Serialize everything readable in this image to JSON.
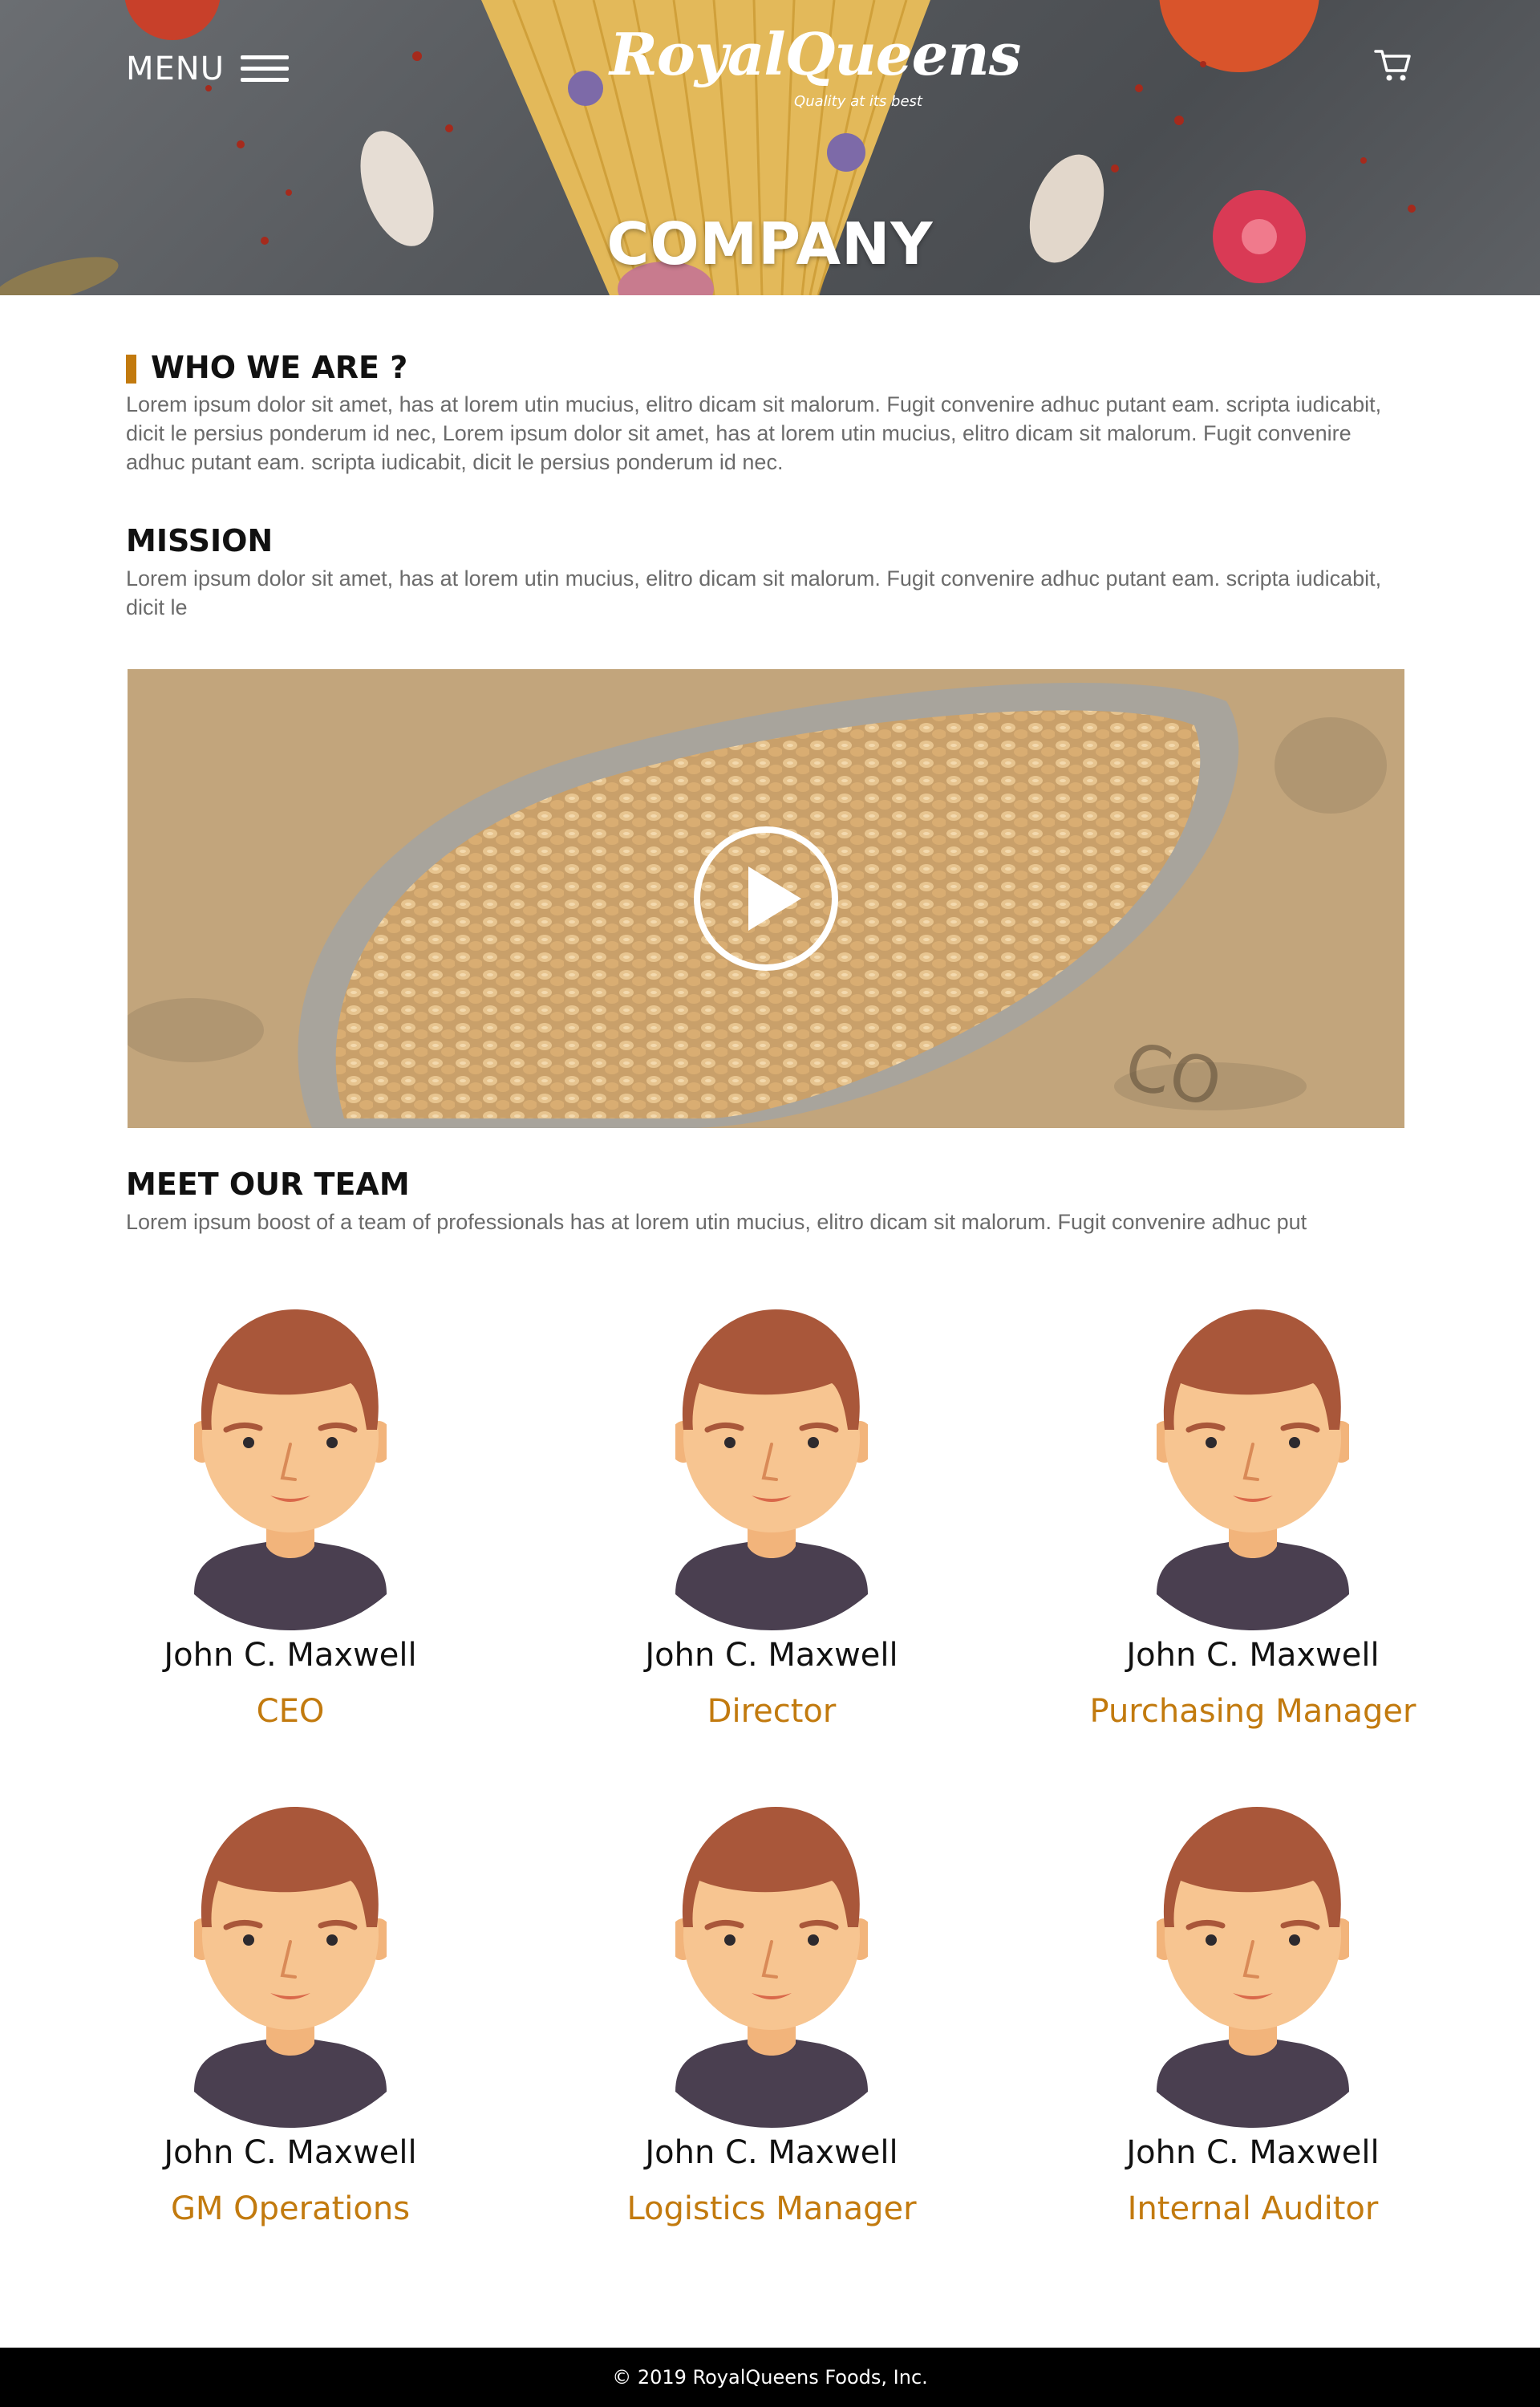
{
  "header": {
    "menu_label": "MENU",
    "logo_name": "RoyalQueens",
    "logo_tagline": "Quality at its best",
    "page_title": "COMPANY"
  },
  "who_we_are": {
    "title": "WHO WE ARE ?",
    "text": "Lorem ipsum dolor sit amet, has at lorem utin mucius, elitro dicam sit malorum. Fugit convenire adhuc putant eam. scripta iudicabit, dicit le persius ponderum id nec, Lorem ipsum dolor sit amet, has at lorem utin mucius, elitro dicam sit malorum. Fugit convenire adhuc putant eam. scripta iudicabit, dicit le persius ponderum id nec."
  },
  "mission": {
    "title": "MISSION",
    "text": "Lorem ipsum dolor sit amet, has at lorem utin mucius, elitro dicam sit malorum. Fugit convenire adhuc putant eam. scripta iudicabit, dicit le"
  },
  "team": {
    "title": "MEET OUR TEAM",
    "text": "Lorem ipsum boost of a team of professionals has at lorem utin mucius, elitro dicam sit malorum. Fugit convenire adhuc put",
    "members": [
      {
        "name": "John C. Maxwell",
        "role": "CEO"
      },
      {
        "name": "John C. Maxwell",
        "role": "Director"
      },
      {
        "name": "John C. Maxwell",
        "role": "Purchasing Manager"
      },
      {
        "name": "John C. Maxwell",
        "role": "GM Operations"
      },
      {
        "name": "John C. Maxwell",
        "role": "Logistics Manager"
      },
      {
        "name": "John C. Maxwell",
        "role": "Internal Auditor"
      }
    ]
  },
  "footer": {
    "copyright": "© 2019 RoyalQueens Foods, Inc."
  },
  "colors": {
    "accent": "#c27a0e",
    "footer_bg": "#000000",
    "body_text": "#6b6b6b"
  },
  "icons": {
    "menu": "hamburger-icon",
    "cart": "cart-icon",
    "video": "play-icon",
    "avatar": "person-avatar"
  }
}
